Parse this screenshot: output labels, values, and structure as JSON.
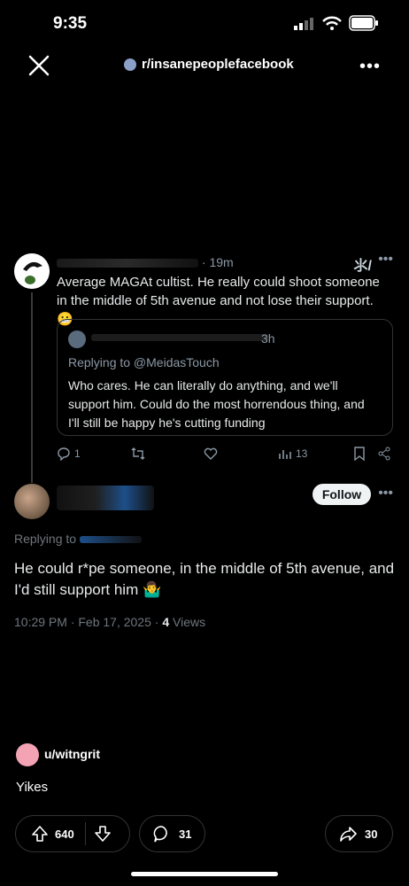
{
  "status": {
    "time": "9:35"
  },
  "header": {
    "subreddit": "r/insanepeoplefacebook",
    "more": "•••"
  },
  "tweet1": {
    "time": "· 19m",
    "text": "Average MAGAt cultist. He really could shoot someone in the middle of 5th avenue and not lose their support. 😬",
    "grok": "⺢/",
    "quote": {
      "time": "3h",
      "replying": "Replying to @MeidasTouch",
      "text": "Who cares. He can literally do anything, and we'll support him. Could do the most horrendous thing, and I'll still be happy he's cutting funding"
    },
    "actions": {
      "replies": "1",
      "views": "13"
    }
  },
  "tweet2": {
    "follow_label": "Follow",
    "replying": "Replying to",
    "text": "He could r*pe someone, in the middle of 5th avenue, and I'd still support him 🤷‍♂️",
    "timestamp": "10:29 PM · Feb 17, 2025 · ",
    "views_count": "4",
    "views_label": " Views"
  },
  "post": {
    "username": "u/witngrit",
    "comment": "Yikes",
    "upvotes": "640",
    "comments": "31",
    "shares": "30"
  },
  "colors": {
    "background": "#000000",
    "muted": "#8b98a5",
    "follow_bg": "#eff3f4"
  }
}
